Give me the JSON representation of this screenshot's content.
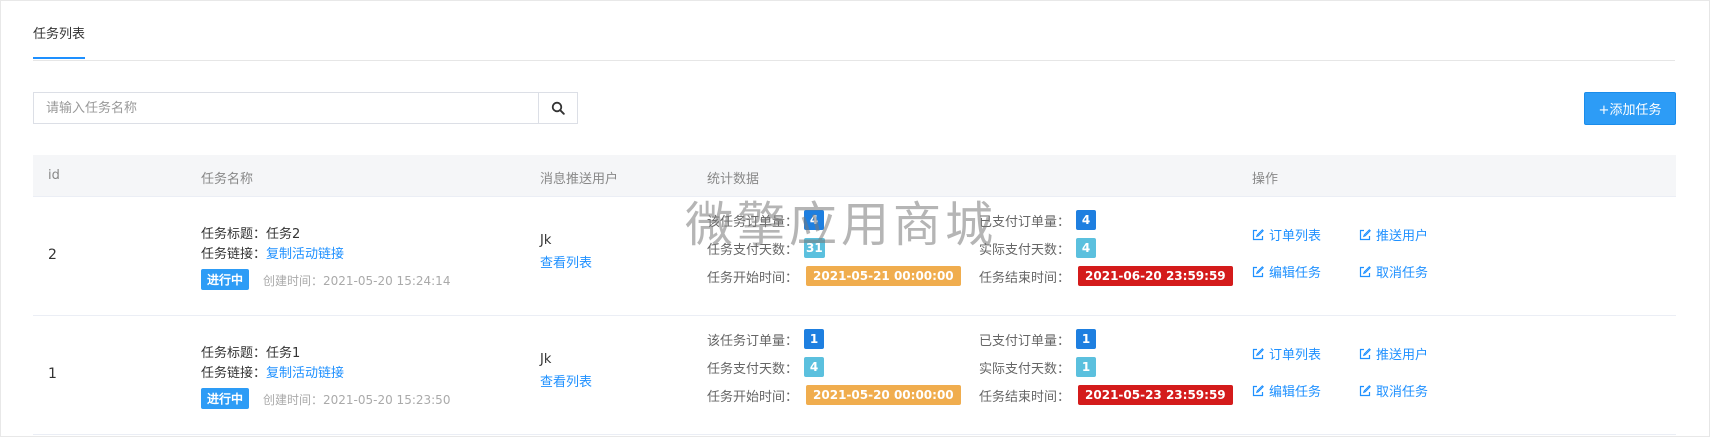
{
  "tabs": {
    "active_label": "任务列表"
  },
  "search": {
    "placeholder": "请输入任务名称",
    "value": ""
  },
  "toolbar": {
    "add_label": "+添加任务"
  },
  "table": {
    "headers": {
      "id": "id",
      "name": "任务名称",
      "push": "消息推送用户",
      "stats": "统计数据",
      "ops": "操作"
    },
    "rows": [
      {
        "id": "2",
        "title": "任务标题：任务2",
        "link_prefix": "任务链接：",
        "link_text": "复制活动链接",
        "status": "进行中",
        "created": "创建时间：2021-05-20 15:24:14",
        "push_user": "Jk",
        "push_link": "查看列表",
        "order_label": "该任务订单量：",
        "order_value": "4",
        "paid_label": "已支付订单量：",
        "paid_value": "4",
        "days_label": "任务支付天数：",
        "days_value": "31",
        "actual_label": "实际支付天数：",
        "actual_value": "4",
        "start_label": "任务开始时间：",
        "start_value": "2021-05-21 00:00:00",
        "end_label": "任务结束时间：",
        "end_value": "2021-06-20 23:59:59",
        "ops": {
          "orders": "订单列表",
          "push": "推送用户",
          "edit": "编辑任务",
          "cancel": "取消任务"
        }
      },
      {
        "id": "1",
        "title": "任务标题：任务1",
        "link_prefix": "任务链接：",
        "link_text": "复制活动链接",
        "status": "进行中",
        "created": "创建时间：2021-05-20 15:23:50",
        "push_user": "Jk",
        "push_link": "查看列表",
        "order_label": "该任务订单量：",
        "order_value": "1",
        "paid_label": "已支付订单量：",
        "paid_value": "1",
        "days_label": "任务支付天数：",
        "days_value": "4",
        "actual_label": "实际支付天数：",
        "actual_value": "1",
        "start_label": "任务开始时间：",
        "start_value": "2021-05-20 00:00:00",
        "end_label": "任务结束时间：",
        "end_value": "2021-05-23 23:59:59",
        "ops": {
          "orders": "订单列表",
          "push": "推送用户",
          "edit": "编辑任务",
          "cancel": "取消任务"
        }
      }
    ]
  },
  "watermark": "微擎应用商城",
  "colors": {
    "accent": "#1e90ff",
    "button": "#2d9cf6",
    "badge_blue": "#1e7fe0",
    "badge_teal": "#5bc0de",
    "date_orange": "#f0ad4e",
    "date_red": "#d41b1b"
  },
  "icons": {
    "search": "search-icon",
    "op": "edit-icon"
  }
}
